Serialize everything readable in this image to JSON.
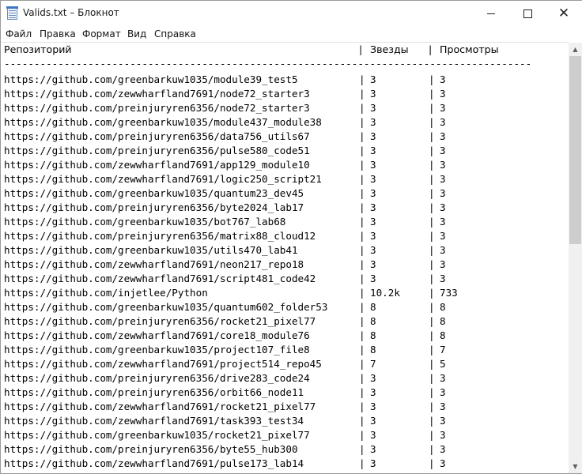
{
  "window": {
    "title": "Valids.txt – Блокнот",
    "minimize_icon": "minimize-icon",
    "maximize_icon": "maximize-icon",
    "close_glyph": "✕"
  },
  "menu": [
    "Файл",
    "Правка",
    "Формат",
    "Вид",
    "Справка"
  ],
  "table": {
    "headers": {
      "repo": "Репозиторий",
      "sep": "|",
      "stars": "Звезды",
      "views": "Просмотры"
    },
    "divider": "----------------------------------------------------------------------------------------",
    "rows": [
      {
        "url": "https://github.com/greenbarkuw1035/module39_test5",
        "stars": "3",
        "views": "3"
      },
      {
        "url": "https://github.com/zewwharfland7691/node72_starter3",
        "stars": "3",
        "views": "3"
      },
      {
        "url": "https://github.com/preinjuryren6356/node72_starter3",
        "stars": "3",
        "views": "3"
      },
      {
        "url": "https://github.com/greenbarkuw1035/module437_module38",
        "stars": "3",
        "views": "3"
      },
      {
        "url": "https://github.com/preinjuryren6356/data756_utils67",
        "stars": "3",
        "views": "3"
      },
      {
        "url": "https://github.com/preinjuryren6356/pulse580_code51",
        "stars": "3",
        "views": "3"
      },
      {
        "url": "https://github.com/zewwharfland7691/app129_module10",
        "stars": "3",
        "views": "3"
      },
      {
        "url": "https://github.com/zewwharfland7691/logic250_script21",
        "stars": "3",
        "views": "3"
      },
      {
        "url": "https://github.com/greenbarkuw1035/quantum23_dev45",
        "stars": "3",
        "views": "3"
      },
      {
        "url": "https://github.com/preinjuryren6356/byte2024_lab17",
        "stars": "3",
        "views": "3"
      },
      {
        "url": "https://github.com/greenbarkuw1035/bot767_lab68",
        "stars": "3",
        "views": "3"
      },
      {
        "url": "https://github.com/preinjuryren6356/matrix88_cloud12",
        "stars": "3",
        "views": "3"
      },
      {
        "url": "https://github.com/greenbarkuw1035/utils470_lab41",
        "stars": "3",
        "views": "3"
      },
      {
        "url": "https://github.com/zewwharfland7691/neon217_repo18",
        "stars": "3",
        "views": "3"
      },
      {
        "url": "https://github.com/zewwharfland7691/script481_code42",
        "stars": "3",
        "views": "3"
      },
      {
        "url": "https://github.com/injetlee/Python",
        "stars": "10.2k",
        "views": "733"
      },
      {
        "url": "https://github.com/greenbarkuw1035/quantum602_folder53",
        "stars": "8",
        "views": "8"
      },
      {
        "url": "https://github.com/preinjuryren6356/rocket21_pixel77",
        "stars": "8",
        "views": "8"
      },
      {
        "url": "https://github.com/zewwharfland7691/core18_module76",
        "stars": "8",
        "views": "8"
      },
      {
        "url": "https://github.com/greenbarkuw1035/project107_file8",
        "stars": "8",
        "views": "7"
      },
      {
        "url": "https://github.com/zewwharfland7691/project514_repo45",
        "stars": "7",
        "views": "5"
      },
      {
        "url": "https://github.com/preinjuryren6356/drive283_code24",
        "stars": "3",
        "views": "3"
      },
      {
        "url": "https://github.com/preinjuryren6356/orbit66_node11",
        "stars": "3",
        "views": "3"
      },
      {
        "url": "https://github.com/zewwharfland7691/rocket21_pixel77",
        "stars": "3",
        "views": "3"
      },
      {
        "url": "https://github.com/zewwharfland7691/task393_test34",
        "stars": "3",
        "views": "3"
      },
      {
        "url": "https://github.com/greenbarkuw1035/rocket21_pixel77",
        "stars": "3",
        "views": "3"
      },
      {
        "url": "https://github.com/preinjuryren6356/byte55_hub300",
        "stars": "3",
        "views": "3"
      },
      {
        "url": "https://github.com/zewwharfland7691/pulse173_lab14",
        "stars": "3",
        "views": "3"
      }
    ]
  },
  "scrollbar": {
    "up_icon": "scroll-up-icon",
    "down_icon": "scroll-down-icon",
    "up_glyph": "▲",
    "down_glyph": "▼"
  }
}
